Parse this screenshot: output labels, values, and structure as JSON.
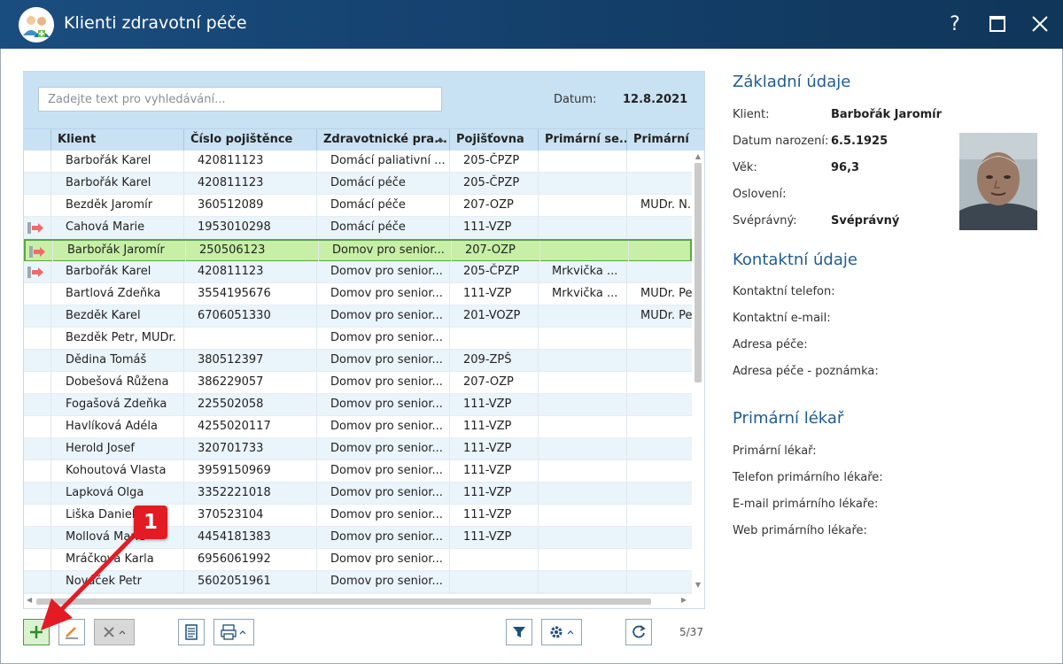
{
  "window": {
    "title": "Klienti zdravotní péče",
    "help_label": "?",
    "colors": {
      "titlebar": "#14406c",
      "accent": "#1f5d92",
      "selected_row": "#c7efa7",
      "header": "#c9e2f3",
      "badge": "#e31b23"
    }
  },
  "search": {
    "placeholder": "Zadejte text pro vyhledávání..."
  },
  "date": {
    "label": "Datum:",
    "value": "12.8.2021"
  },
  "table": {
    "columns": [
      "Klient",
      "Číslo pojištěnce",
      "Zdravotnické pra...",
      "Pojišťovna",
      "Primární se...",
      "Primární lé..."
    ],
    "sorted_column": "Zdravotnické pra...",
    "rows": [
      {
        "klient": "Barbořák Karel",
        "cislo": "420811123",
        "zdrav": "Domácí paliativní ...",
        "poj": "205-ČPZP",
        "se": "",
        "le": "",
        "indicator": false
      },
      {
        "klient": "Barbořák Karel",
        "cislo": "420811123",
        "zdrav": "Domácí péče",
        "poj": "205-ČPZP",
        "se": "",
        "le": "",
        "indicator": false
      },
      {
        "klient": "Bezděk Jaromír",
        "cislo": "360512089",
        "zdrav": "Domácí péče",
        "poj": "207-OZP",
        "se": "",
        "le": "MUDr. N.",
        "indicator": false
      },
      {
        "klient": "Cahová Marie",
        "cislo": "1953010298",
        "zdrav": "Domácí péče",
        "poj": "111-VZP",
        "se": "",
        "le": "",
        "indicator": true
      },
      {
        "klient": "Barbořák Jaromír",
        "cislo": "250506123",
        "zdrav": "Domov pro senior...",
        "poj": "207-OZP",
        "se": "",
        "le": "",
        "indicator": true,
        "selected": true
      },
      {
        "klient": "Barbořák Karel",
        "cislo": "420811123",
        "zdrav": "Domov pro senior...",
        "poj": "205-ČPZP",
        "se": "Mrkvička ...",
        "le": "",
        "indicator": true
      },
      {
        "klient": "Bartlová Zdeňka",
        "cislo": "3554195676",
        "zdrav": "Domov pro senior...",
        "poj": "111-VZP",
        "se": "Mrkvička ...",
        "le": "MUDr. Pe",
        "indicator": false
      },
      {
        "klient": "Bezděk Karel",
        "cislo": "6706051330",
        "zdrav": "Domov pro senior...",
        "poj": "201-VOZP",
        "se": "",
        "le": "MUDr. Pe",
        "indicator": false
      },
      {
        "klient": "Bezděk Petr, MUDr.",
        "cislo": "",
        "zdrav": "Domov pro senior...",
        "poj": "",
        "se": "",
        "le": "",
        "indicator": false
      },
      {
        "klient": "Dědina Tomáš",
        "cislo": "380512397",
        "zdrav": "Domov pro senior...",
        "poj": "209-ZPŠ",
        "se": "",
        "le": "",
        "indicator": false
      },
      {
        "klient": "Dobešová Růžena",
        "cislo": "386229057",
        "zdrav": "Domov pro senior...",
        "poj": "207-OZP",
        "se": "",
        "le": "",
        "indicator": false
      },
      {
        "klient": "Fogašová Zdeňka",
        "cislo": "225502058",
        "zdrav": "Domov pro senior...",
        "poj": "111-VZP",
        "se": "",
        "le": "",
        "indicator": false
      },
      {
        "klient": "Havlíková Adéla",
        "cislo": "4255020117",
        "zdrav": "Domov pro senior...",
        "poj": "111-VZP",
        "se": "",
        "le": "",
        "indicator": false
      },
      {
        "klient": "Herold Josef",
        "cislo": "320701733",
        "zdrav": "Domov pro senior...",
        "poj": "111-VZP",
        "se": "",
        "le": "",
        "indicator": false
      },
      {
        "klient": "Kohoutová Vlasta",
        "cislo": "3959150969",
        "zdrav": "Domov pro senior...",
        "poj": "111-VZP",
        "se": "",
        "le": "",
        "indicator": false
      },
      {
        "klient": "Lapková Olga",
        "cislo": "3352221018",
        "zdrav": "Domov pro senior...",
        "poj": "111-VZP",
        "se": "",
        "le": "",
        "indicator": false
      },
      {
        "klient": "Liška Daniel",
        "cislo": "370523104",
        "zdrav": "Domov pro senior...",
        "poj": "111-VZP",
        "se": "",
        "le": "",
        "indicator": false
      },
      {
        "klient": "Mollová Marie",
        "cislo": "4454181383",
        "zdrav": "Domov pro senior...",
        "poj": "111-VZP",
        "se": "",
        "le": "",
        "indicator": false
      },
      {
        "klient": "Mráčková Karla",
        "cislo": "6956061992",
        "zdrav": "Domov pro senior...",
        "poj": "",
        "se": "",
        "le": "",
        "indicator": false
      },
      {
        "klient": "Nováček Petr",
        "cislo": "5602051961",
        "zdrav": "Domov pro senior...",
        "poj": "",
        "se": "",
        "le": "",
        "indicator": false
      }
    ]
  },
  "toolbar": {
    "add_icon": "plus-icon",
    "edit_icon": "pencil-icon",
    "delete_icon": "x-icon",
    "document_icon": "document-icon",
    "print_icon": "printer-icon",
    "filter_icon": "filter-icon",
    "settings_icon": "gear-icon",
    "refresh_icon": "refresh-icon",
    "record_count": "5/37"
  },
  "detail": {
    "basic": {
      "title": "Základní údaje",
      "client_label": "Klient:",
      "client_value": "Barbořák Jaromír",
      "dob_label": "Datum narození:",
      "dob_value": "6.5.1925",
      "age_label": "Věk:",
      "age_value": "96,3",
      "salutation_label": "Oslovení:",
      "salutation_value": "",
      "competent_label": "Svéprávný:",
      "competent_value": "Svéprávný"
    },
    "contact": {
      "title": "Kontaktní údaje",
      "phone_label": "Kontaktní telefon:",
      "email_label": "Kontaktní e-mail:",
      "address_label": "Adresa péče:",
      "address_note_label": "Adresa péče - poznámka:"
    },
    "doctor": {
      "title": "Primární lékař",
      "doctor_label": "Primární lékař:",
      "phone_label": "Telefon primárního lékaře:",
      "email_label": "E-mail primárního lékaře:",
      "web_label": "Web primárního lékaře:"
    }
  },
  "annotation": {
    "badge_number": "1"
  }
}
